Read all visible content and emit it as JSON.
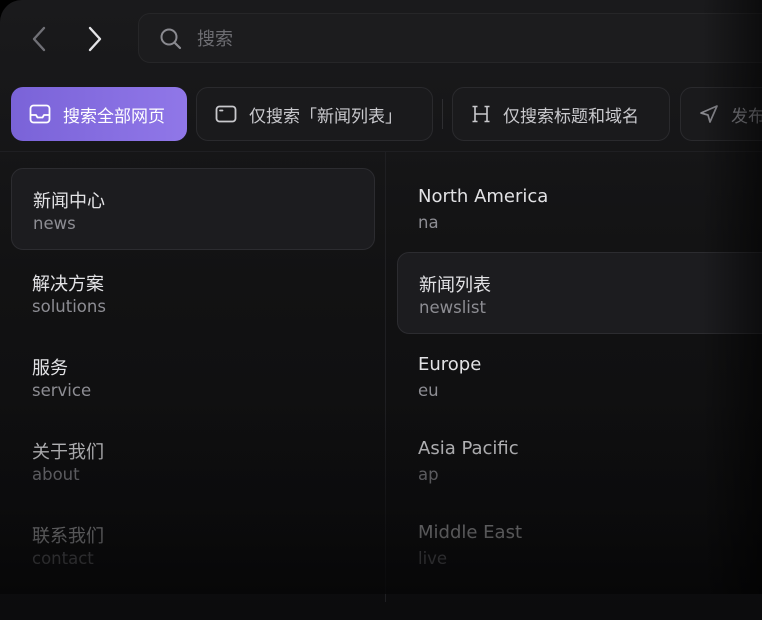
{
  "nav": {
    "back_icon": "chevron-left-icon",
    "forward_icon": "chevron-right-icon"
  },
  "search": {
    "placeholder": "搜索",
    "value": "",
    "icon": "search-icon"
  },
  "scopes": [
    {
      "label": "搜索全部网页",
      "icon": "inbox-icon",
      "active": true
    },
    {
      "label": "仅搜索「新闻列表」",
      "icon": "window-icon",
      "active": false
    },
    {
      "label": "仅搜索标题和域名",
      "icon": "heading-icon",
      "active": false
    },
    {
      "label": "发布",
      "icon": "send-icon",
      "active": false
    }
  ],
  "left_items": [
    {
      "title": "新闻中心",
      "slug": "news",
      "selected": true
    },
    {
      "title": "解决方案",
      "slug": "solutions",
      "selected": false
    },
    {
      "title": "服务",
      "slug": "service",
      "selected": false
    },
    {
      "title": "关于我们",
      "slug": "about",
      "selected": false
    },
    {
      "title": "联系我们",
      "slug": "contact",
      "selected": false
    }
  ],
  "right_items": [
    {
      "title": "North America",
      "slug": "na",
      "selected": false
    },
    {
      "title": "新闻列表",
      "slug": "newslist",
      "selected": true
    },
    {
      "title": "Europe",
      "slug": "eu",
      "selected": false
    },
    {
      "title": "Asia Pacific",
      "slug": "ap",
      "selected": false
    },
    {
      "title": "Middle East",
      "slug": "live",
      "selected": false
    }
  ],
  "colors": {
    "accent_start": "#7a63d8",
    "accent_end": "#9077e8",
    "background": "#121213",
    "text_primary": "#e2e2e5",
    "text_secondary": "#8d8d93"
  }
}
